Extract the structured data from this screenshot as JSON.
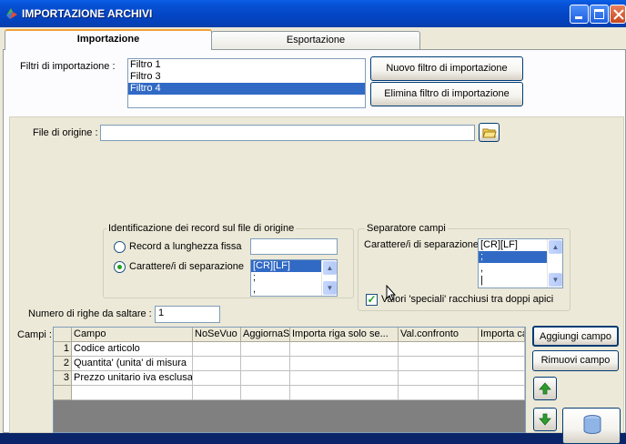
{
  "window": {
    "title": "IMPORTAZIONE ARCHIVI",
    "buttons": {
      "minimize": "minimize-icon",
      "maximize": "maximize-icon",
      "close": "close-icon"
    }
  },
  "tabs": [
    {
      "label": "Importazione",
      "active": true
    },
    {
      "label": "Esportazione",
      "active": false
    }
  ],
  "filters": {
    "label": "Filtri di importazione :",
    "items": [
      "Filtro 1",
      "Filtro 3",
      "Filtro 4"
    ],
    "selected": "Filtro 4",
    "new_button": "Nuovo filtro di importazione",
    "delete_button": "Elimina filtro di importazione"
  },
  "source": {
    "label": "File di origine :",
    "value": ""
  },
  "record_id": {
    "title": "Identificazione dei record sul file di origine",
    "option_fixed": "Record a lunghezza fissa",
    "option_sep": "Carattere/i di separazione",
    "fixed_value": "",
    "selected_option": "sep",
    "sep_items": [
      "[CR][LF]",
      ";",
      ","
    ],
    "sep_selected": "[CR][LF]"
  },
  "field_sep": {
    "title": "Separatore campi",
    "label": "Carattere/i di separazione",
    "items": [
      "[CR][LF]",
      ";",
      ",",
      "|"
    ],
    "selected": ";",
    "special_checkbox": "Valori 'speciali' racchiusi tra doppi apici",
    "special_checked": true
  },
  "skip_rows": {
    "label": "Numero di righe da saltare  :",
    "value": "1"
  },
  "fields": {
    "label": "Campi :",
    "columns": [
      "Campo",
      "NoSeVuo",
      "AggiornaS",
      "Importa riga solo se...",
      "Val.confronto",
      "Importa ca"
    ],
    "rows": [
      {
        "n": "1",
        "campo": "Codice articolo"
      },
      {
        "n": "2",
        "campo": "Quantita' (unita' di misura"
      },
      {
        "n": "3",
        "campo": "Prezzo unitario iva esclusa"
      }
    ],
    "add_button": "Aggiungi campo",
    "remove_button": "Rimuovi campo"
  },
  "colors": {
    "selection": "#316ac5",
    "titlebar": "#0446c5",
    "face": "#ece9d8"
  }
}
